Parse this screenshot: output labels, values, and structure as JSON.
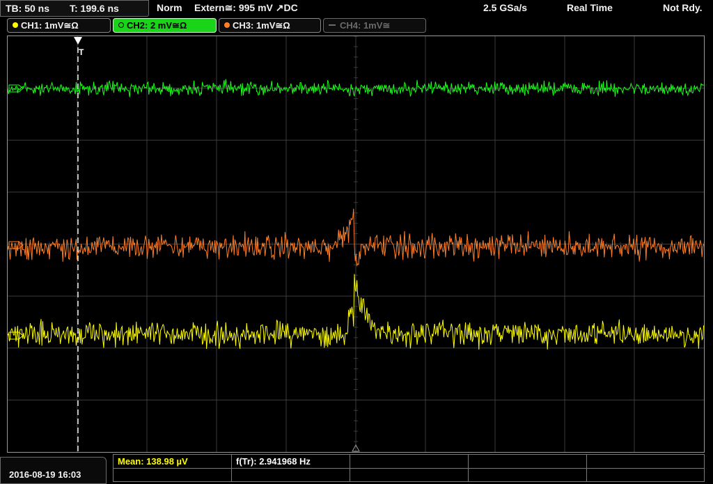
{
  "header": {
    "timebase": "TB: 50 ns",
    "trigger_time": "T: 199.6 ns",
    "acq_mode": "Norm",
    "trigger_source": "Extern≅: 995 mV ↗DC",
    "sample_rate": "2.5 GSa/s",
    "time_mode": "Real Time",
    "status": "Not Rdy."
  },
  "channels": [
    {
      "label": "CH1: 1mV≅Ω",
      "color": "#ffff00",
      "state": "on"
    },
    {
      "label": "CH2: 2 mV≅Ω",
      "color": "#19d419",
      "state": "selected"
    },
    {
      "label": "CH3: 1mV≅Ω",
      "color": "#ff7f27",
      "state": "on"
    },
    {
      "label": "CH4: 1mV≅",
      "color": "#6a6a6a",
      "state": "off"
    }
  ],
  "colors": {
    "ch1": "#ffff00",
    "ch2": "#19ff19",
    "ch3": "#ff7f27",
    "grid": "#3c3c3c",
    "cursor": "#ffffff"
  },
  "screen": {
    "trigger_marker": "T"
  },
  "footer": {
    "datetime": "2016-08-19 16:03",
    "measurement_mean": "Mean: 138.98 µV",
    "measurement_freq": "f(Tr): 2.941968 Hz"
  }
}
